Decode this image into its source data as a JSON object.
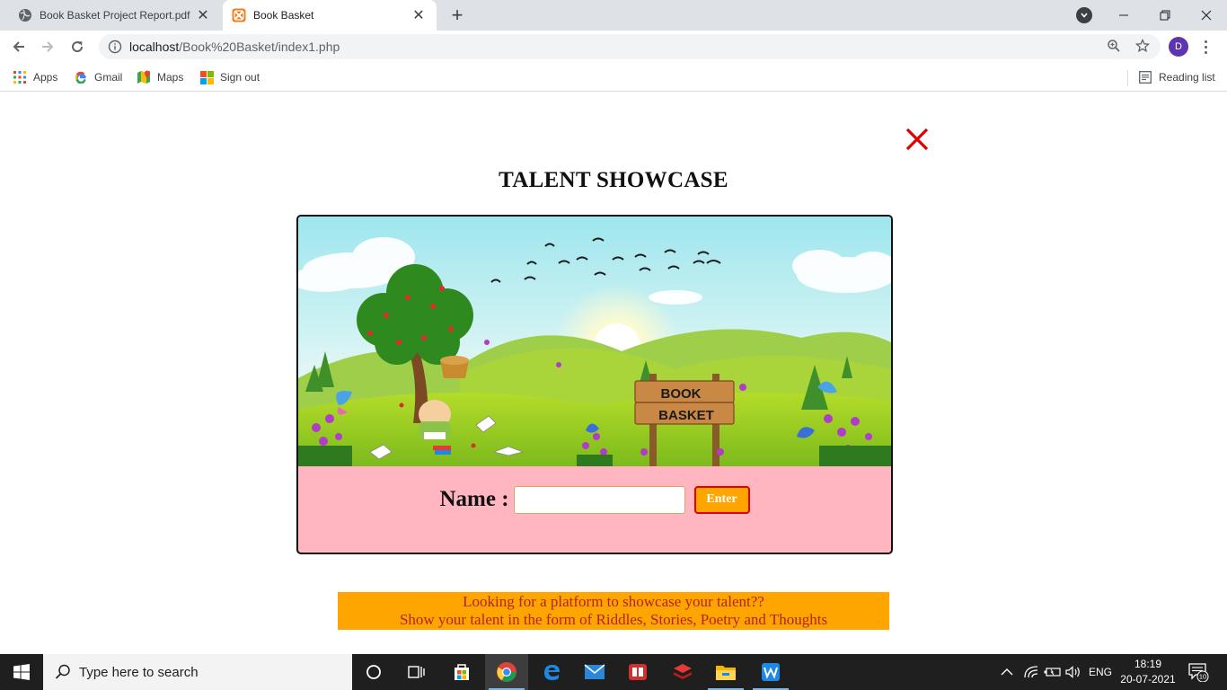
{
  "browser": {
    "tabs": [
      {
        "title": "Book Basket Project Report.pdf",
        "active": false
      },
      {
        "title": "Book Basket",
        "active": true
      }
    ],
    "url_host": "localhost",
    "url_path": "/Book%20Basket/index1.php",
    "profile_initial": "D",
    "bookmarks": [
      {
        "label": "Apps",
        "icon": "apps-grid-icon"
      },
      {
        "label": "Gmail",
        "icon": "google-g-icon"
      },
      {
        "label": "Maps",
        "icon": "maps-icon"
      },
      {
        "label": "Sign out",
        "icon": "windows-logo-icon"
      }
    ],
    "reading_list": "Reading list"
  },
  "page": {
    "title": "TALENT SHOWCASE",
    "banner_sign_line1": "BOOK",
    "banner_sign_line2": "BASKET",
    "name_label": "Name :",
    "name_value": "",
    "enter_label": "Enter",
    "tagline_line1": "Looking for a platform to showcase your talent??",
    "tagline_line2": "Show your talent in the form of Riddles, Stories, Poetry and Thoughts",
    "colors": {
      "card_bg": "#ffb6c1",
      "tagline_bg": "#ffa500",
      "tagline_text": "#b22222",
      "button_bg": "#ffa500",
      "button_border": "#e00000",
      "close_icon": "#e00000"
    }
  },
  "taskbar": {
    "search_placeholder": "Type here to search",
    "language": "ENG",
    "time": "18:19",
    "date": "20-07-2021",
    "notification_count": "10"
  }
}
